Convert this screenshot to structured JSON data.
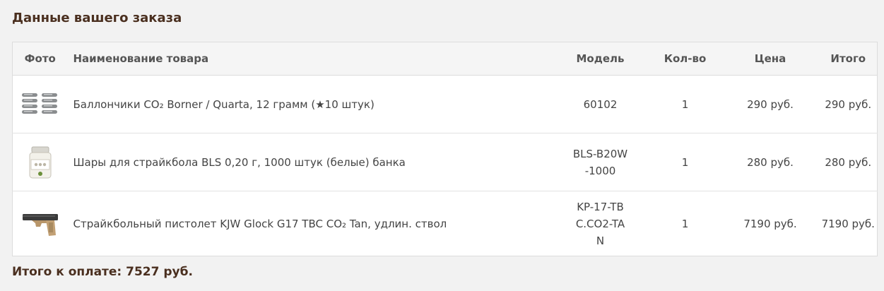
{
  "heading": "Данные вашего заказа",
  "table": {
    "headers": {
      "photo": "Фото",
      "name": "Наименование товара",
      "model": "Модель",
      "qty": "Кол-во",
      "price": "Цена",
      "total": "Итого"
    },
    "rows": [
      {
        "name": "Баллончики CO₂ Borner / Quarta, 12 грамм (★10 штук)",
        "model": "60102",
        "qty": "1",
        "price": "290 руб.",
        "total": "290 руб.",
        "photo_icon": "co2-cartridges-icon"
      },
      {
        "name": "Шары для страйкбола BLS 0,20 г, 1000 штук (белые) банка",
        "model": "BLS-B20W-1000",
        "qty": "1",
        "price": "280 руб.",
        "total": "280 руб.",
        "photo_icon": "bb-jar-icon"
      },
      {
        "name": "Страйкбольный пистолет KJW Glock G17 TBC CO₂ Tan, удлин. ствол",
        "model": "KP-17-TBC.CO2-TAN",
        "qty": "1",
        "price": "7190 руб.",
        "total": "7190 руб.",
        "photo_icon": "pistol-icon"
      }
    ]
  },
  "order_total": "Итого к оплате: 7527 руб.",
  "colors": {
    "heading": "#4a2f1f",
    "background": "#f2f2f2",
    "table_bg": "#ffffff"
  }
}
